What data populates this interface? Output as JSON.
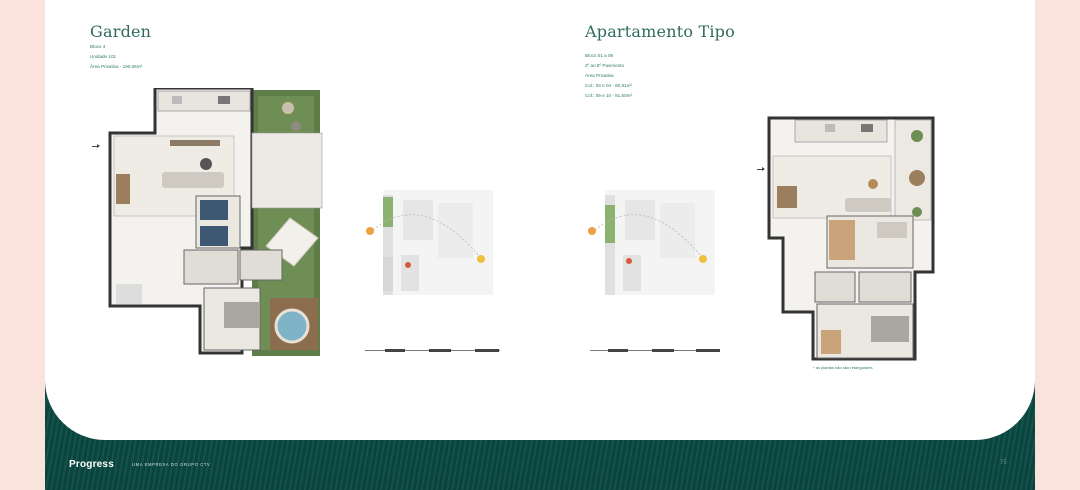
{
  "left": {
    "title": "Garden",
    "lines": [
      "Bloco 4",
      "Unidade 101",
      "Área Privativa - 180,06m²"
    ]
  },
  "right": {
    "title": "Apartamento Tipo",
    "lines": [
      "Bloco 01 a 06",
      "2º ao 8º Pavimento",
      "Área Privativa",
      "Col.: 03 e 04 - 80,81m²",
      "Col.: 09 e 10 - 81,60m²"
    ],
    "footnote": "* as plantas não são retangulares"
  },
  "footer": {
    "brand": "Progress",
    "tagline": "UMA EMPRESA DO GRUPO CTV",
    "page_number": "75"
  },
  "colors": {
    "accent": "#2e6b5e",
    "footer_bg": "#0f5a52",
    "outer_bg": "#f9e3dc"
  }
}
